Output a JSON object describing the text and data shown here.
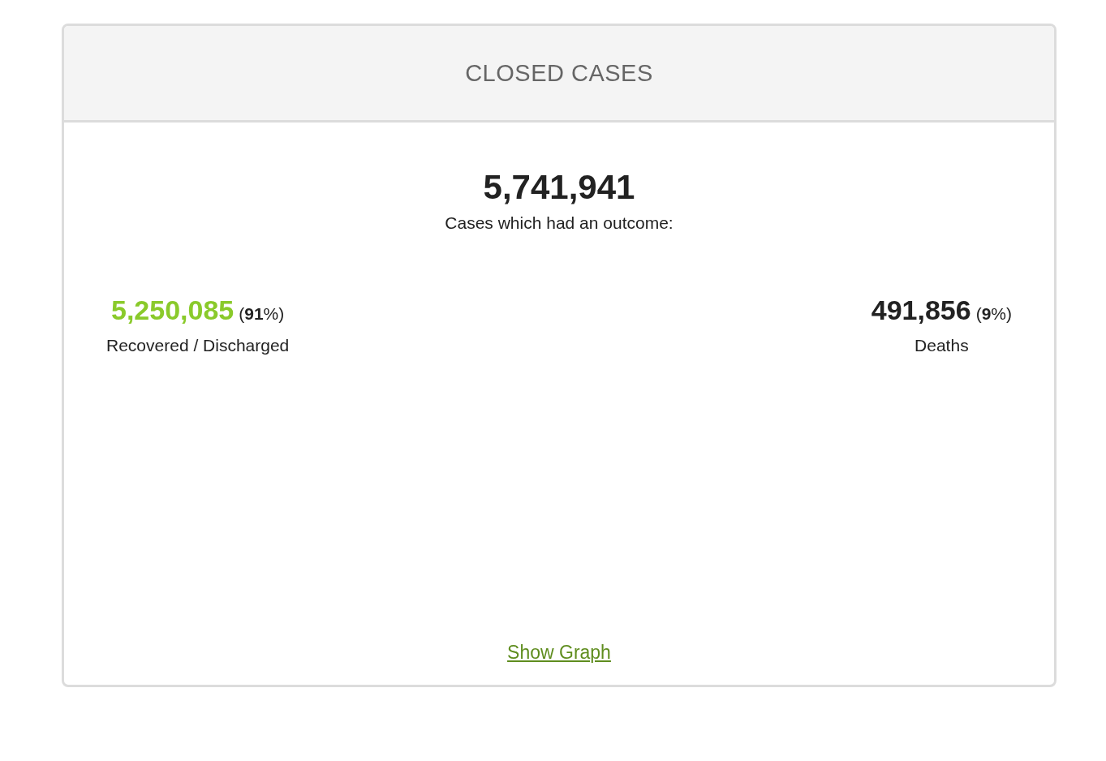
{
  "panel": {
    "title": "CLOSED CASES",
    "total": "5,741,941",
    "total_label": "Cases which had an outcome:",
    "stats": [
      {
        "value": "5,250,085",
        "percent": "(**91**%)",
        "label": "Recovered / Discharged",
        "color": "#8aca2b"
      },
      {
        "value": "491,856",
        "percent": "(**9**%)",
        "label": "Deaths",
        "color": "#222222"
      }
    ],
    "link": "Show Graph"
  }
}
